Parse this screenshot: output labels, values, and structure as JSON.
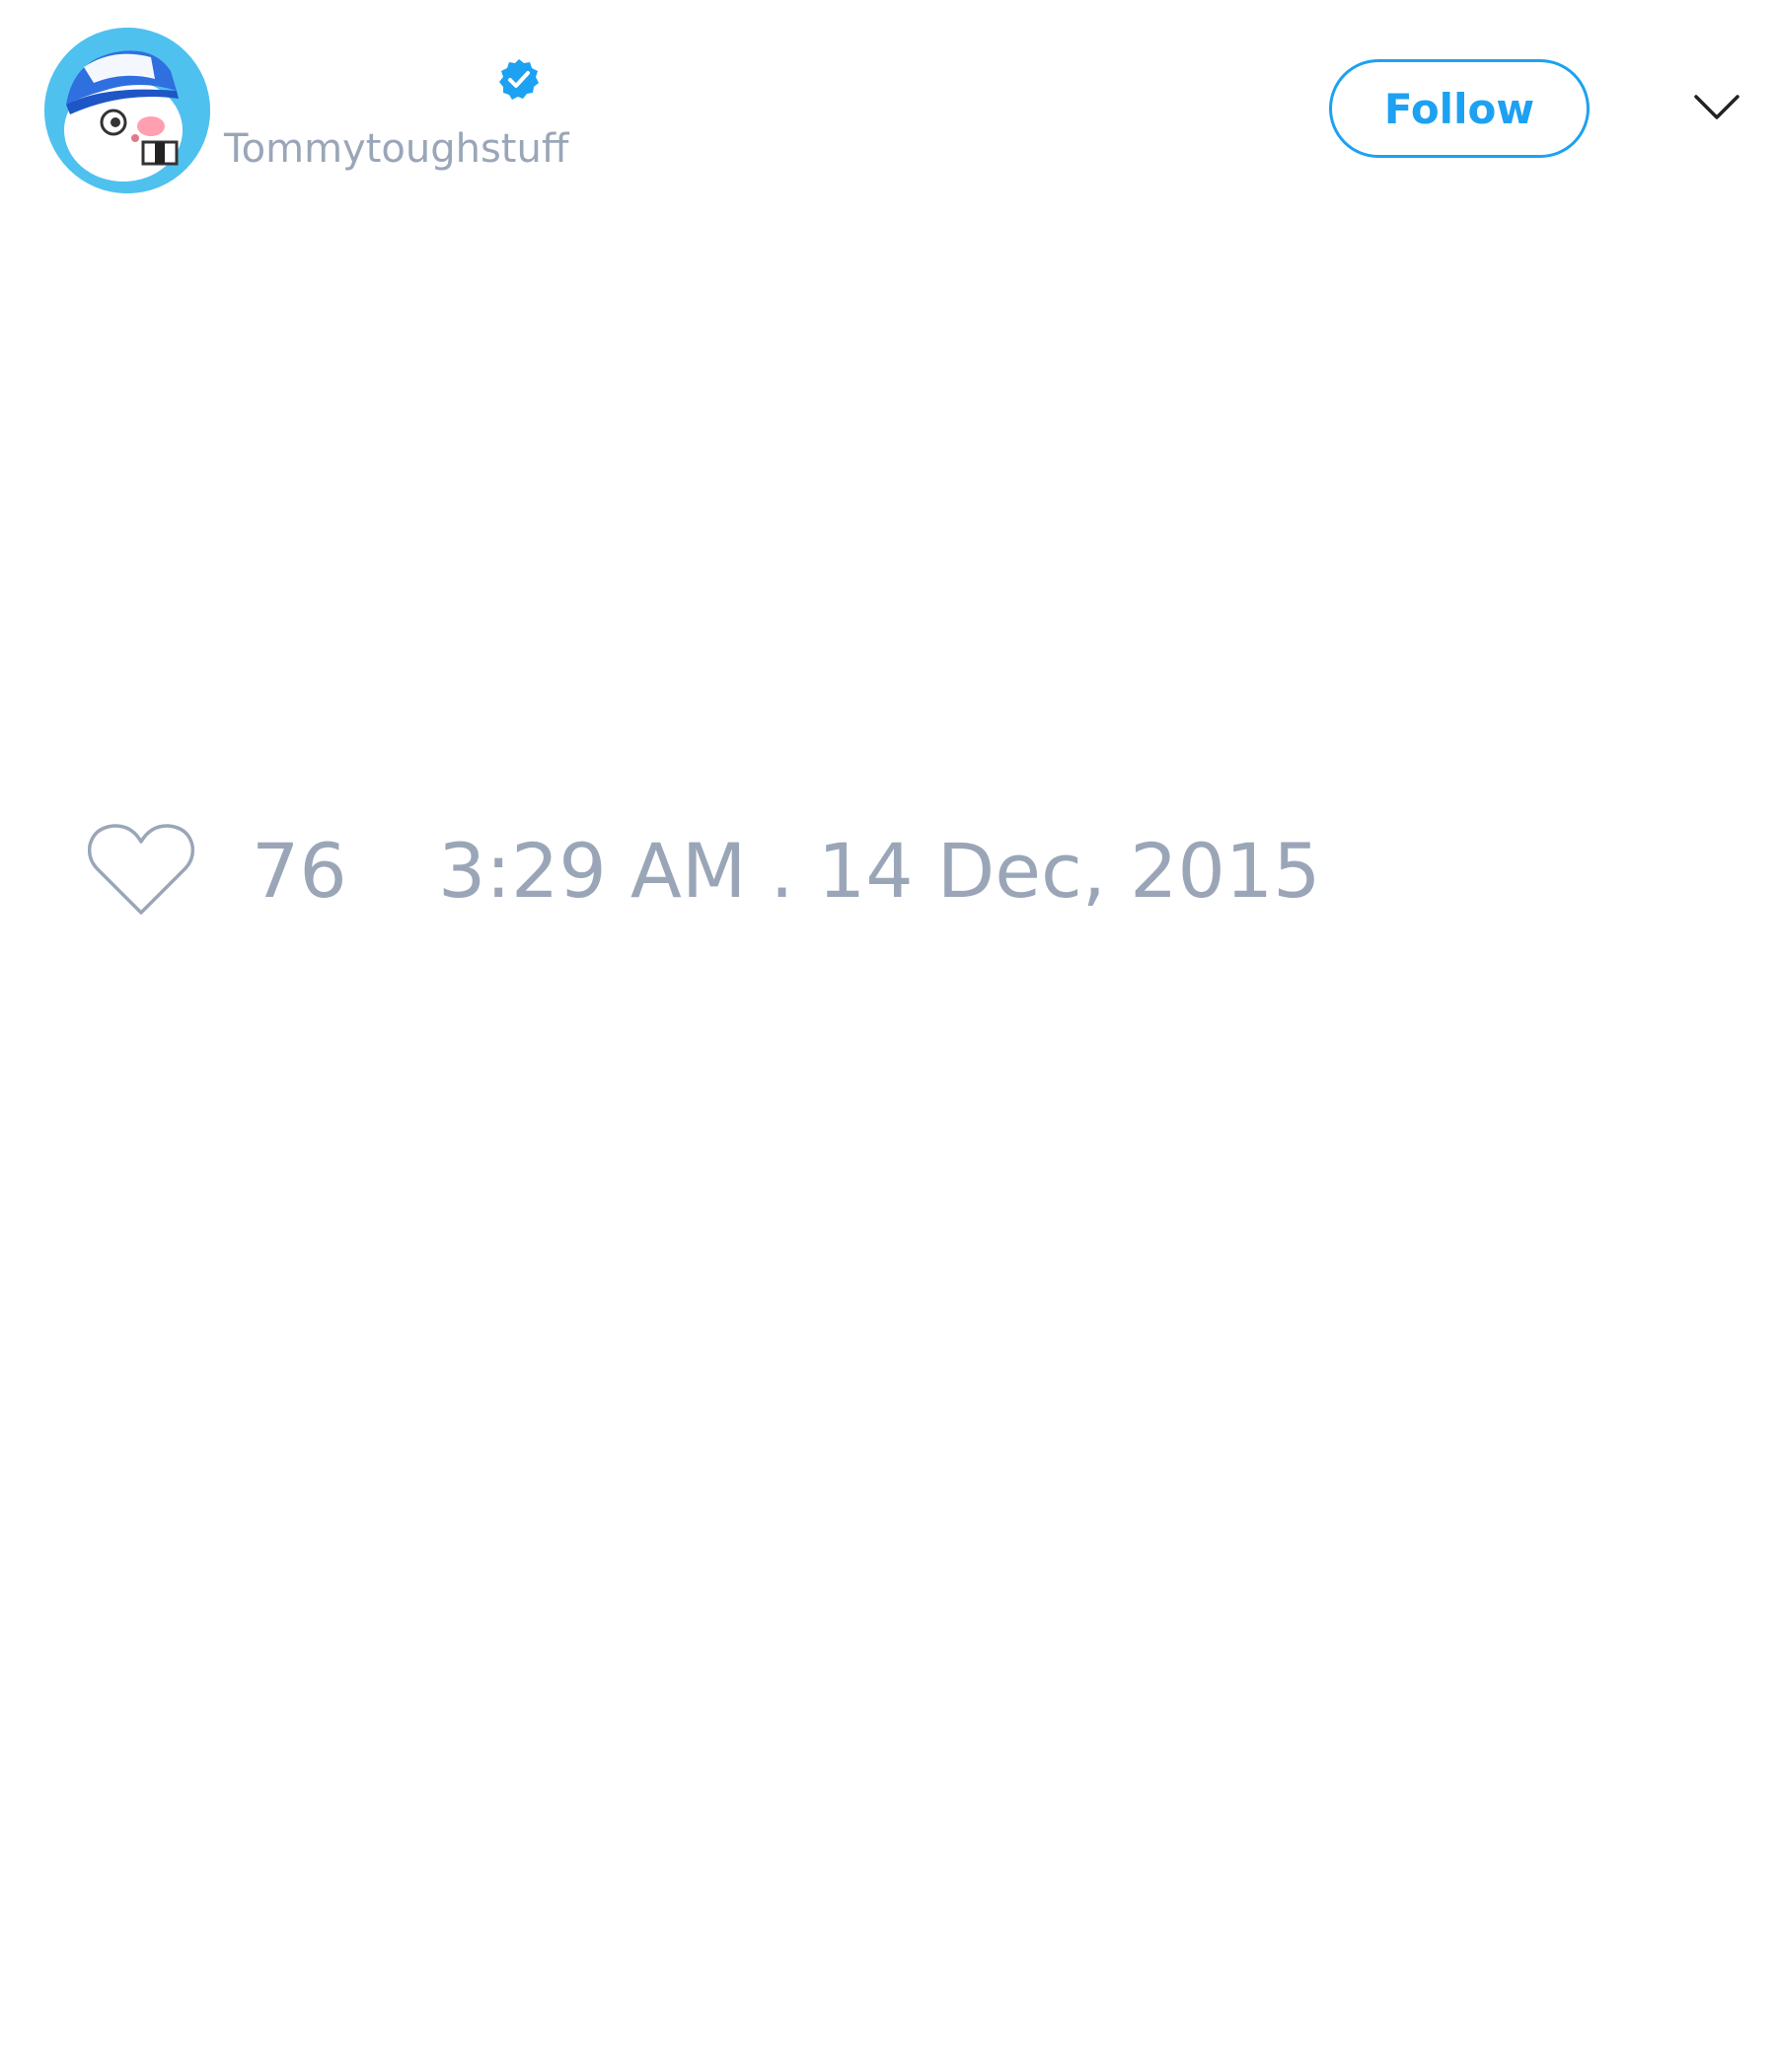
{
  "author": {
    "handle": "Tommytoughstuff",
    "verified": true,
    "avatar_icon": "cartoon-face-with-cap"
  },
  "actions": {
    "follow_label": "Follow",
    "menu_icon": "chevron-down-icon"
  },
  "stats": {
    "like_icon": "heart-icon",
    "like_count": "76",
    "timestamp": "3:29 AM . 14 Dec, 2015"
  },
  "colors": {
    "accent": "#1da1f2",
    "muted_text": "#9aa6b8",
    "avatar_background": "#4fc1ef"
  }
}
